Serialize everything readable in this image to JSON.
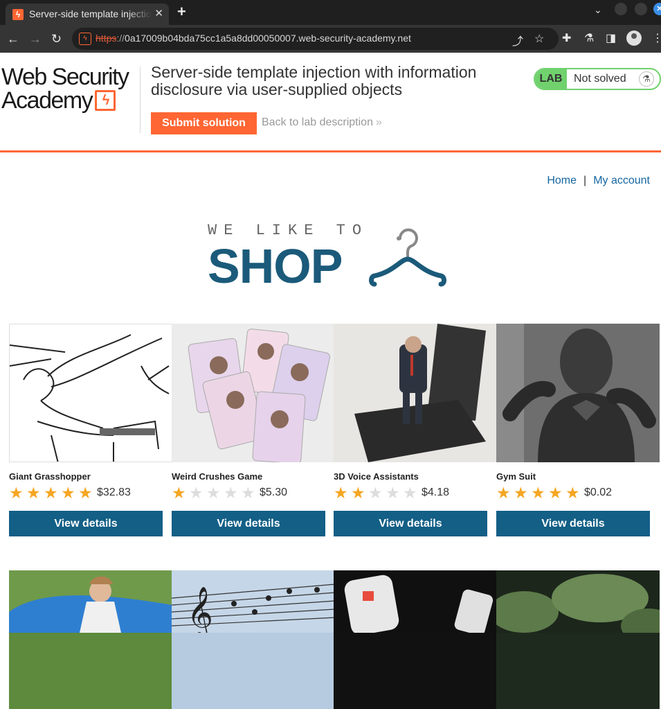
{
  "browser": {
    "tab_title": "Server-side template injection with information disclosure via user-supplied objects",
    "url_scheme": "https",
    "url_sep": "://",
    "url_host": "0a17009b04bda75cc1a5a8dd00050007.web-security-academy.net",
    "icons": [
      "back-arrow",
      "forward-arrow",
      "reload",
      "share",
      "star",
      "extensions",
      "labs-flask",
      "side-panel",
      "profile",
      "menu"
    ]
  },
  "lab_header": {
    "logo_line1": "Web Security",
    "logo_line2": "Academy",
    "title": "Server-side template injection with information disclosure via user-supplied objects",
    "submit_label": "Submit solution",
    "back_label": "Back to lab description",
    "badge_lab": "LAB",
    "badge_status": "Not solved",
    "accent_color": "#ff6633",
    "status_color": "#70d16d"
  },
  "nav": {
    "home": "Home",
    "separator": "|",
    "account": "My account"
  },
  "shop_logo": {
    "tagline": "WE LIKE TO",
    "word": "SHOP"
  },
  "products": [
    {
      "name": "Giant Grasshopper",
      "rating": 5,
      "price": "$32.83",
      "button": "View details"
    },
    {
      "name": "Weird Crushes Game",
      "rating": 1,
      "price": "$5.30",
      "button": "View details"
    },
    {
      "name": "3D Voice Assistants",
      "rating": 2,
      "price": "$4.18",
      "button": "View details"
    },
    {
      "name": "Gym Suit",
      "rating": 5,
      "price": "$0.02",
      "button": "View details"
    }
  ]
}
